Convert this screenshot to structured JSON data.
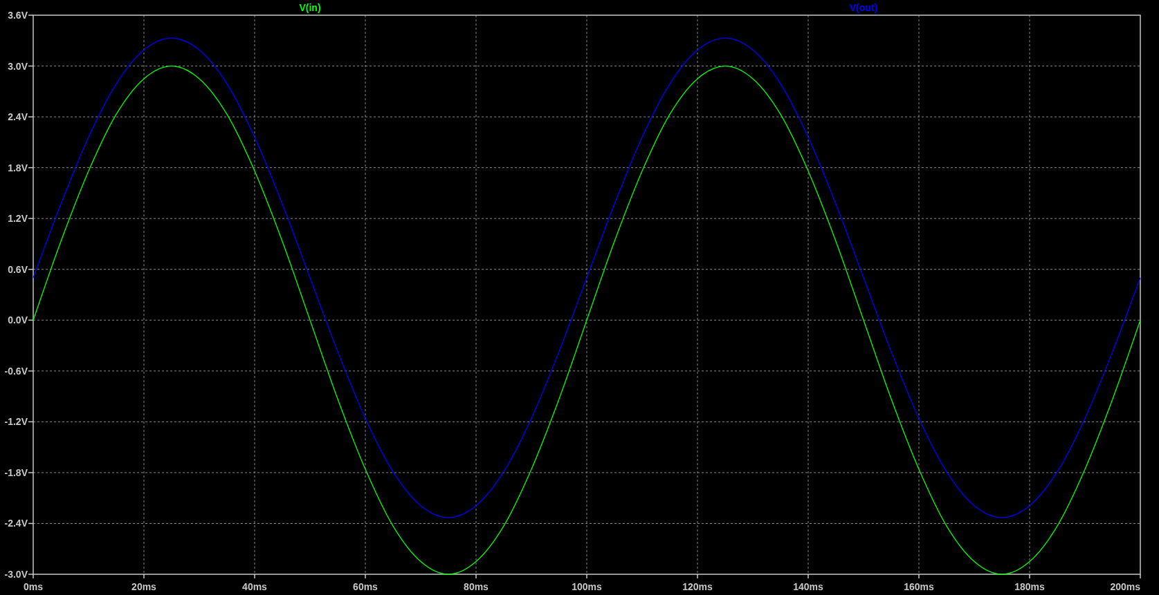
{
  "chart_data": {
    "type": "line",
    "grid": true,
    "xlim": [
      0,
      200
    ],
    "ylim": [
      -3,
      3.6
    ],
    "xticks": [
      {
        "value": 0,
        "label": "0ms"
      },
      {
        "value": 20,
        "label": "20ms"
      },
      {
        "value": 40,
        "label": "40ms"
      },
      {
        "value": 60,
        "label": "60ms"
      },
      {
        "value": 80,
        "label": "80ms"
      },
      {
        "value": 100,
        "label": "100ms"
      },
      {
        "value": 120,
        "label": "120ms"
      },
      {
        "value": 140,
        "label": "140ms"
      },
      {
        "value": 160,
        "label": "160ms"
      },
      {
        "value": 180,
        "label": "180ms"
      },
      {
        "value": 200,
        "label": "200ms"
      }
    ],
    "yticks": [
      {
        "value": 3.6,
        "label": "3.6V"
      },
      {
        "value": 3.0,
        "label": "3.0V"
      },
      {
        "value": 2.4,
        "label": "2.4V"
      },
      {
        "value": 1.8,
        "label": "1.8V"
      },
      {
        "value": 1.2,
        "label": "1.2V"
      },
      {
        "value": 0.6,
        "label": "0.6V"
      },
      {
        "value": 0,
        "label": "0.0V"
      },
      {
        "value": -0.6,
        "label": "-0.6V"
      },
      {
        "value": -1.2,
        "label": "-1.2V"
      },
      {
        "value": -1.8,
        "label": "-1.8V"
      },
      {
        "value": -2.4,
        "label": "-2.4V"
      },
      {
        "value": -3.0,
        "label": "-3.0V"
      }
    ],
    "x": [
      0,
      5,
      10,
      15,
      20,
      25,
      30,
      35,
      40,
      45,
      50,
      55,
      60,
      65,
      70,
      75,
      80,
      85,
      90,
      95,
      100,
      105,
      110,
      115,
      120,
      125,
      130,
      135,
      140,
      145,
      150,
      155,
      160,
      165,
      170,
      175,
      180,
      185,
      190,
      195,
      200
    ],
    "series": [
      {
        "name": "V(in)",
        "color": "#00ff00",
        "values": [
          0,
          0.93,
          1.76,
          2.43,
          2.85,
          3,
          2.85,
          2.43,
          1.76,
          0.93,
          0,
          -0.93,
          -1.76,
          -2.43,
          -2.85,
          -3,
          -2.85,
          -2.43,
          -1.76,
          -0.93,
          0,
          0.93,
          1.76,
          2.43,
          2.85,
          3,
          2.85,
          2.43,
          1.76,
          0.93,
          0,
          -0.93,
          -1.76,
          -2.43,
          -2.85,
          -3,
          -2.85,
          -2.43,
          -1.76,
          -0.93,
          0
        ]
      },
      {
        "name": "V(out)",
        "color": "#0000ff",
        "values": [
          0.5,
          1.37,
          2.16,
          2.79,
          3.19,
          3.33,
          3.19,
          2.79,
          2.16,
          1.37,
          0.5,
          -0.37,
          -1.16,
          -1.79,
          -2.19,
          -2.33,
          -2.19,
          -1.79,
          -1.16,
          -0.37,
          0.5,
          1.37,
          2.16,
          2.79,
          3.19,
          3.33,
          3.19,
          2.79,
          2.16,
          1.37,
          0.5,
          -0.37,
          -1.16,
          -1.79,
          -2.19,
          -2.33,
          -2.19,
          -1.79,
          -1.16,
          -0.37,
          0.5
        ]
      }
    ]
  }
}
